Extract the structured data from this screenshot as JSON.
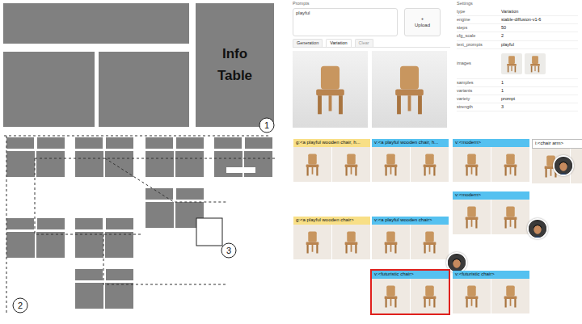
{
  "diagram": {
    "info_table": "Info Table",
    "markers": [
      "1",
      "2",
      "3"
    ]
  },
  "prompt": {
    "label": "Prompts",
    "value": "playful",
    "upload_icon": "+",
    "upload_label": "Upload"
  },
  "tabs": [
    {
      "label": "Generation",
      "selected": false,
      "disabled": false
    },
    {
      "label": "Variation",
      "selected": true,
      "disabled": false
    },
    {
      "label": "Clear",
      "selected": false,
      "disabled": true
    }
  ],
  "settings": {
    "label": "Settings",
    "rows": [
      {
        "kind": "text",
        "key": "type",
        "value": "Variation"
      },
      {
        "kind": "text",
        "key": "engine",
        "value": "stable-diffusion-v1-6"
      },
      {
        "kind": "text",
        "key": "steps",
        "value": "50"
      },
      {
        "kind": "text",
        "key": "cfg_scale",
        "value": "2"
      },
      {
        "kind": "text",
        "key": "text_prompts",
        "value": "playful"
      },
      {
        "kind": "images",
        "key": "images",
        "value": ""
      },
      {
        "kind": "text",
        "key": "samples",
        "value": "1"
      },
      {
        "kind": "text",
        "key": "variants",
        "value": "1"
      },
      {
        "kind": "text",
        "key": "variety",
        "value": "prompt"
      },
      {
        "kind": "text",
        "key": "strength",
        "value": "3"
      }
    ]
  },
  "tree": {
    "nodes": [
      {
        "kind": "generation",
        "label": "g:<a playful wooden chair, h...",
        "highlighted": false,
        "avatar": false
      },
      {
        "kind": "variation",
        "label": "v:<a playful wooden chair, h...",
        "highlighted": false,
        "avatar": false
      },
      {
        "kind": "variation",
        "label": "v:<modern>",
        "highlighted": false,
        "avatar": false
      },
      {
        "kind": "inpaint",
        "label": "i:<chair arm>",
        "highlighted": false,
        "avatar": true
      },
      {
        "kind": "variation",
        "label": "v:<modern>",
        "highlighted": false,
        "avatar": true
      },
      {
        "kind": "generation",
        "label": "g:<a playful wooden chair>",
        "highlighted": false,
        "avatar": false
      },
      {
        "kind": "variation",
        "label": "v:<a playful wooden chair>",
        "highlighted": false,
        "avatar": true
      },
      {
        "kind": "variation",
        "label": "v:<futuristic chair>",
        "highlighted": true,
        "avatar": false
      },
      {
        "kind": "variation",
        "label": "v:<futuristic chair>",
        "highlighted": false,
        "avatar": false
      }
    ]
  }
}
